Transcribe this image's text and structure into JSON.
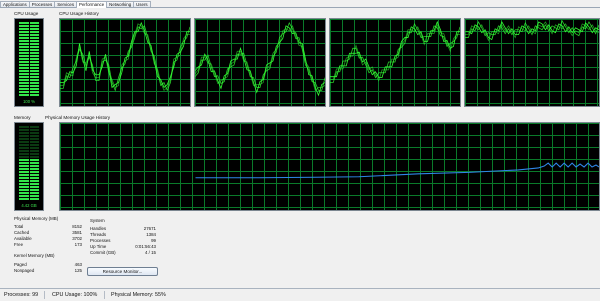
{
  "tabs": [
    {
      "label": "Applications",
      "active": false
    },
    {
      "label": "Processes",
      "active": false
    },
    {
      "label": "Services",
      "active": false
    },
    {
      "label": "Performance",
      "active": true
    },
    {
      "label": "Networking",
      "active": false
    },
    {
      "label": "Users",
      "active": false
    }
  ],
  "labels": {
    "cpu_usage": "CPU Usage",
    "cpu_history": "CPU Usage History",
    "memory": "Memory",
    "memory_history": "Physical Memory Usage History"
  },
  "meters": {
    "cpu": {
      "text": "100 %",
      "level": 1.0,
      "color": "#34e64a"
    },
    "memory": {
      "text": "4.42 GB",
      "level": 0.55,
      "color": "#34e64a"
    }
  },
  "physical_memory": {
    "title": "Physical Memory (MB)",
    "rows": [
      {
        "label": "Total",
        "value": "8152"
      },
      {
        "label": "Cached",
        "value": "3581"
      },
      {
        "label": "Available",
        "value": "3702"
      },
      {
        "label": "Free",
        "value": "173"
      }
    ]
  },
  "kernel_memory": {
    "title": "Kernel Memory (MB)",
    "rows": [
      {
        "label": "Paged",
        "value": "463"
      },
      {
        "label": "Nonpaged",
        "value": "125"
      }
    ]
  },
  "system": {
    "title": "System",
    "rows": [
      {
        "label": "Handles",
        "value": "27671"
      },
      {
        "label": "Threads",
        "value": "1384"
      },
      {
        "label": "Processes",
        "value": "99"
      },
      {
        "label": "Up Time",
        "value": "0:01:56:43"
      },
      {
        "label": "Commit (GB)",
        "value": "4 / 15"
      }
    ]
  },
  "resource_monitor_button": "Resource Monitor...",
  "status": {
    "processes": "Processes: 99",
    "cpu": "CPU Usage: 100%",
    "memory": "Physical Memory: 55%"
  },
  "colors": {
    "graph_line": "#33ff33",
    "memory_line": "#2f86e8",
    "grid": "#0a7a2a"
  }
}
